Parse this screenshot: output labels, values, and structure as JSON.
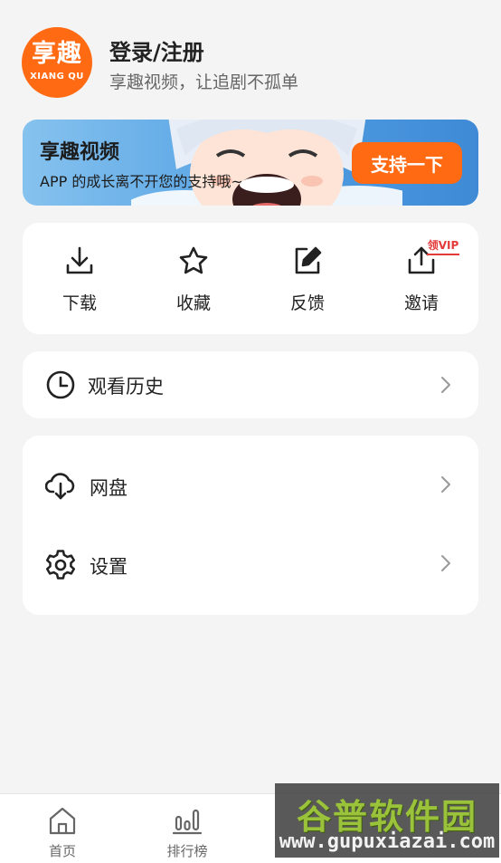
{
  "profile": {
    "logo_main": "享趣",
    "logo_sub": "XIANG QU",
    "title": "登录/注册",
    "subtitle": "享趣视频，让追剧不孤单"
  },
  "banner": {
    "title": "享趣视频",
    "text": "APP 的成长离不开您的支持哦~",
    "button": "支持一下"
  },
  "quick_actions": [
    {
      "label": "下载",
      "icon": "download-icon"
    },
    {
      "label": "收藏",
      "icon": "star-icon"
    },
    {
      "label": "反馈",
      "icon": "edit-icon"
    },
    {
      "label": "邀请",
      "icon": "share-icon",
      "tag": "领VIP"
    }
  ],
  "history": {
    "label": "观看历史",
    "icon": "clock-icon"
  },
  "menu": [
    {
      "label": "网盘",
      "icon": "cloud-download-icon"
    },
    {
      "label": "设置",
      "icon": "gear-icon"
    }
  ],
  "tabbar": [
    {
      "label": "首页",
      "icon": "home-icon"
    },
    {
      "label": "排行榜",
      "icon": "ranking-icon"
    }
  ],
  "watermark": {
    "title": "谷普软件园",
    "url": "www.gupuxiazai.com"
  },
  "colors": {
    "accent": "#ff6a13",
    "background": "#f4f4f4",
    "card": "#ffffff",
    "vip_tag": "#e43a3a"
  }
}
